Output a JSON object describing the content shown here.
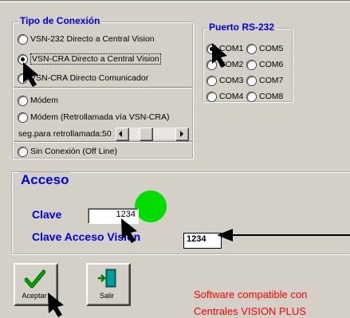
{
  "connection": {
    "title": "Tipo de Conexión",
    "options": [
      {
        "label": "VSN-232 Directo a Central Vision",
        "selected": false
      },
      {
        "label": "VSN-CRA Directo a Central Vision",
        "selected": true
      },
      {
        "label": "VSN-CRA Directo Comunicador",
        "selected": false
      }
    ],
    "modem": {
      "label": "Módem",
      "selected": false
    },
    "modem_callback": {
      "label": "Módem (Retrollamada vía VSN-CRA)",
      "selected": false
    },
    "callback_seconds_label": "seg.para retrollamada:50",
    "offline": {
      "label": "Sin Conexión (Off Line)",
      "selected": false
    }
  },
  "port": {
    "title": "Puerto RS-232",
    "options": [
      {
        "label": "COM1",
        "selected": true
      },
      {
        "label": "COM5",
        "selected": false
      },
      {
        "label": "COM2",
        "selected": false
      },
      {
        "label": "COM6",
        "selected": false
      },
      {
        "label": "COM3",
        "selected": false
      },
      {
        "label": "COM7",
        "selected": false
      },
      {
        "label": "COM4",
        "selected": false
      },
      {
        "label": "COM8",
        "selected": false
      }
    ]
  },
  "access": {
    "title": "Acceso",
    "clave_label": "Clave",
    "clave_value": "1234",
    "vision_label": "Clave Acceso Vision",
    "vision_value": "1234",
    "status_color": "#00dd00"
  },
  "buttons": {
    "accept_label": "Aceptar",
    "exit_label": "Salir"
  },
  "footer": {
    "line1": "Software compatible con",
    "line2": "Centrales VISION PLUS"
  },
  "colors": {
    "window_bg": "#d4d0c8",
    "accent_blue": "#0000e8",
    "footer_red": "#ff0000"
  }
}
